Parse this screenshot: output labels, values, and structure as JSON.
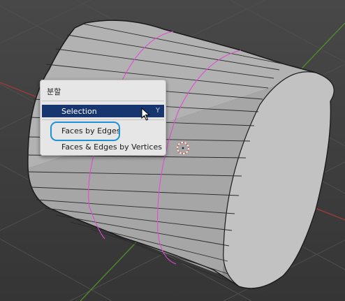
{
  "menu": {
    "title": "분할",
    "items": [
      {
        "label": "Selection",
        "shortcut": "Y",
        "active": true
      },
      {
        "label": "Faces by Edges",
        "shortcut": "",
        "active": false
      },
      {
        "label": "Faces & Edges by Vertices",
        "shortcut": "",
        "active": false
      }
    ]
  },
  "colors": {
    "viewport_bg": "#3d3d3d",
    "mesh_face": "#9f9f9f",
    "seam": "#e24bd4",
    "axis_x": "#9c3a3a",
    "axis_y": "#4f8a2a",
    "menu_highlight": "#173670",
    "focus_ring": "#1e90d6"
  },
  "icons": [
    "mouse-cursor-icon",
    "3d-cursor-icon"
  ]
}
